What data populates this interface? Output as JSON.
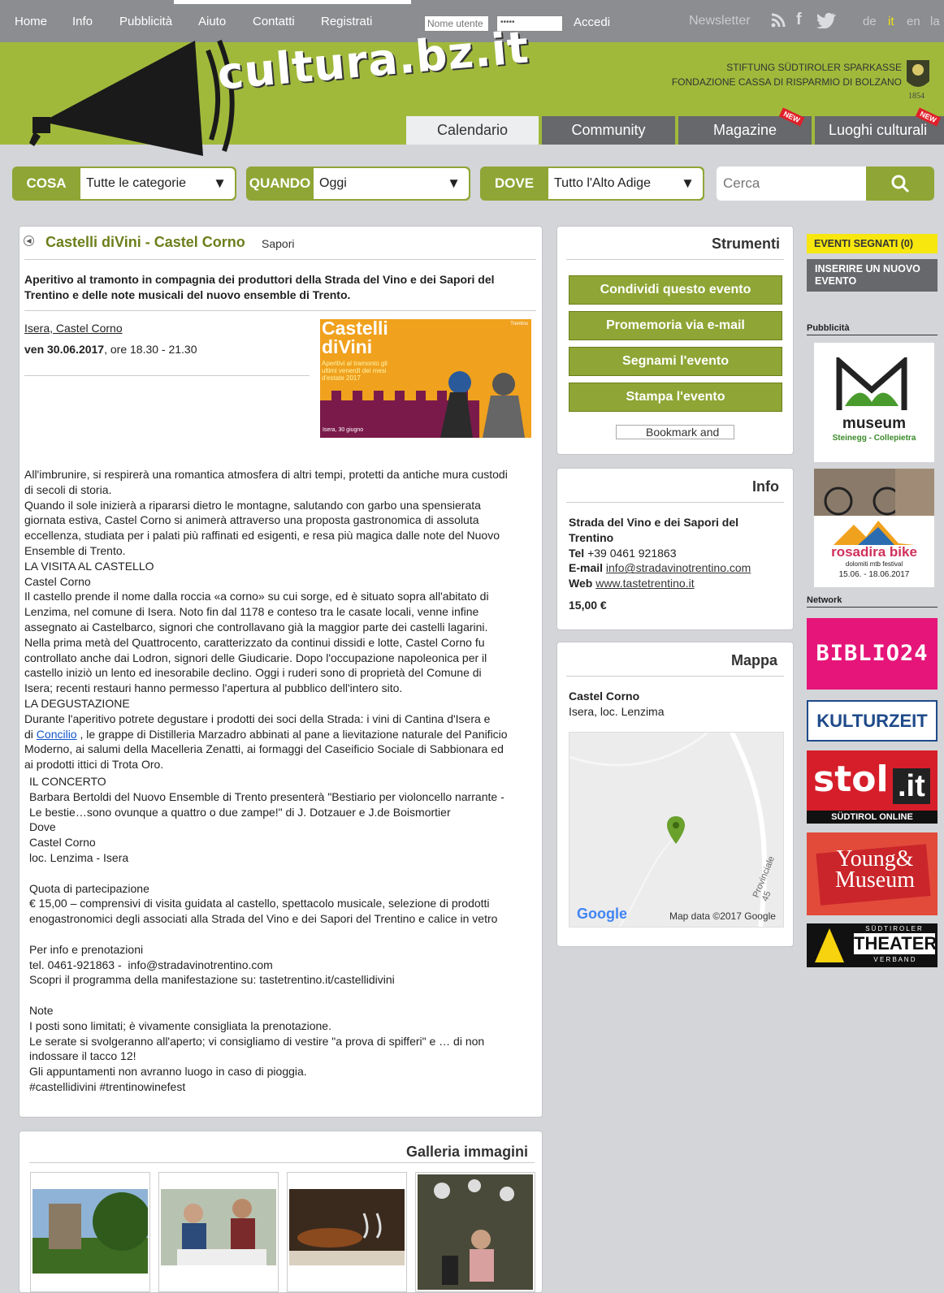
{
  "topnav": {
    "items": [
      "Home",
      "Info",
      "Pubblicità",
      "Aiuto",
      "Contatti",
      "Registrati"
    ],
    "username_placeholder": "Nome utente",
    "password_value": "•••••",
    "login": "Accedi",
    "newsletter": "Newsletter",
    "languages": [
      "de",
      "it",
      "en",
      "la"
    ],
    "active_lang": "it"
  },
  "header": {
    "logo": "cultura.bz.it",
    "foundation": [
      "STIFTUNG SÜDTIROLER SPARKASSE",
      "FONDAZIONE CASSA DI RISPARMIO DI BOLZANO"
    ],
    "year": "1854"
  },
  "tabs": [
    {
      "label": "Calendario"
    },
    {
      "label": "Community"
    },
    {
      "label": "Magazine",
      "badge": "NEW"
    },
    {
      "label": "Luoghi culturali",
      "badge": "NEW"
    }
  ],
  "filters": {
    "cosa": {
      "label": "COSA",
      "value": "Tutte le categorie"
    },
    "quando": {
      "label": "QUANDO",
      "value": "Oggi"
    },
    "dove": {
      "label": "DOVE",
      "value": "Tutto l'Alto Adige"
    },
    "search_placeholder": "Cerca"
  },
  "event": {
    "title": "Castelli diVini - Castel Corno",
    "category": "Sapori",
    "subtitle": "Aperitivo al tramonto in compagnia dei produttori della Strada del Vino e dei Sapori del Trentino e delle note musicali del nuovo ensemble di Trento.",
    "location": "Isera, Castel Corno",
    "date_bold": "ven 30.06.2017",
    "date_rest": ", ore 18.30 - 21.30",
    "poster": {
      "title1": "Castelli",
      "title2": "diVini",
      "tag": "Aperitivi al tramonto gli ultimi venerdì dei mesi d'estate 2017",
      "place": "Isera, 30 giugno",
      "brand": "Trentino"
    },
    "desc_lines": [
      "All'imbrunire, si respirerà una romantica atmosfera di altri tempi, protetti da antiche mura custodi",
      "di secoli di storia.",
      "Quando il sole inizierà a ripararsi dietro le montagne, salutando con garbo una spensierata",
      "giornata estiva, Castel Corno si animerà attraverso una proposta gastronomica di assoluta",
      "eccellenza, studiata per i palati più raffinati ed esigenti, e resa più magica dalle note del Nuovo",
      "Ensemble di Trento.",
      "LA VISITA AL CASTELLO",
      "Castel Corno",
      "Il castello prende il nome dalla roccia «a corno» su cui sorge, ed è situato sopra all'abitato di",
      "Lenzima, nel comune di Isera. Noto fin dal 1178 e conteso tra le casate locali, venne infine",
      "assegnato ai Castelbarco, signori che controllavano già la maggior parte dei castelli lagarini.",
      "Nella prima metà del Quattrocento, caratterizzato da continui dissidi e lotte, Castel Corno fu",
      "controllato anche dai Lodron, signori delle Giudicarie. Dopo l'occupazione napoleonica per il",
      "castello iniziò un lento ed inesorabile declino. Oggi i ruderi sono di proprietà del Comune di",
      "Isera; recenti restauri hanno permesso l'apertura al pubblico dell'intero sito.",
      "LA DEGUSTAZIONE",
      "Durante l'aperitivo potrete degustare i prodotti dei soci della Strada: i vini di Cantina d'Isera e"
    ],
    "desc_link_pre": "di ",
    "desc_link": "Concilio",
    "desc_link_post": " , le grappe di Distilleria Marzadro abbinati al pane a lievitazione naturale del Panificio",
    "desc_lines_b": [
      "Moderno, ai salumi della Macelleria Zenatti, ai formaggi del Caseificio Sociale di Sabbionara ed",
      "ai prodotti ittici di Trota Oro."
    ],
    "desc2_lines": [
      "IL CONCERTO",
      "Barbara Bertoldi del Nuovo Ensemble di Trento presenterà \"Bestiario per violoncello narrante -",
      "Le bestie…sono ovunque a quattro o due zampe!\" di J. Dotzauer e J.de Boismortier",
      "Dove",
      "Castel Corno",
      "loc. Lenzima - Isera",
      "",
      "Quota di partecipazione",
      "€ 15,00 – comprensivi di visita guidata al castello, spettacolo musicale, selezione di prodotti",
      "enogastronomici degli associati alla Strada del Vino e dei Sapori del Trentino e calice in vetro",
      "",
      "Per info e prenotazioni",
      "tel. 0461-921863 -  info@stradavinotrentino.com",
      "Scopri il programma della manifestazione su: tastetrentino.it/castellidivini",
      "",
      "Note",
      "I posti sono limitati; è vivamente consigliata la prenotazione.",
      "Le serate si svolgeranno all'aperto; vi consigliamo di vestire \"a prova di spifferi\" e … di non",
      "indossare il tacco 12!",
      "Gli appuntamenti non avranno luogo in caso di pioggia.",
      "#castellidivini #trentinowinefest"
    ]
  },
  "gallery": {
    "title": "Galleria immagini"
  },
  "tools": {
    "title": "Strumenti",
    "buttons": [
      "Condividi questo evento",
      "Promemoria via e-mail",
      "Segnami l'evento",
      "Stampa l'evento"
    ],
    "bookmark": "Bookmark and"
  },
  "info": {
    "title": "Info",
    "org1": "Strada del Vino e dei Sapori del",
    "org2": "Trentino",
    "tel_label": "Tel",
    "tel": " +39 0461 921863",
    "email_label": "E-mail",
    "email": "info@stradavinotrentino.com",
    "web_label": "Web",
    "web": "www.tastetrentino.it",
    "price": "15,00 €"
  },
  "map": {
    "title": "Mappa",
    "place": "Castel Corno",
    "address": "Isera, loc. Lenzima",
    "road": "Provinciale 45",
    "google": "Google",
    "mapdata": "Map data ©2017 Google"
  },
  "sidebar": {
    "segnati": "EVENTI SEGNATI   (0)",
    "inserire": "INSERIRE UN NUOVO EVENTO",
    "pubblicita": "Pubblicità",
    "network": "Network",
    "ads": {
      "museum": "museum",
      "museum_sub": "Steinegg - Collepietra",
      "bike": "rosadira bike",
      "bike_sub": "dolomiti mtb festival",
      "bike_dates": "15.06. - 18.06.2017",
      "biblio": "BIBLIO24",
      "kultur": "KULTURZEIT",
      "stol": "stol",
      "stol_suffix": ".it",
      "stol_sub": "SÜDTIROL ONLINE",
      "young": "Young&",
      "young2": "Museum",
      "theater_top": "SÜDTIROLER",
      "theater": "THEATER",
      "theater_bottom": "V E R B A N D"
    }
  },
  "colors": {
    "accent": "#8fa535",
    "banner": "#a1b93b",
    "title_green": "#6b7f1b"
  }
}
